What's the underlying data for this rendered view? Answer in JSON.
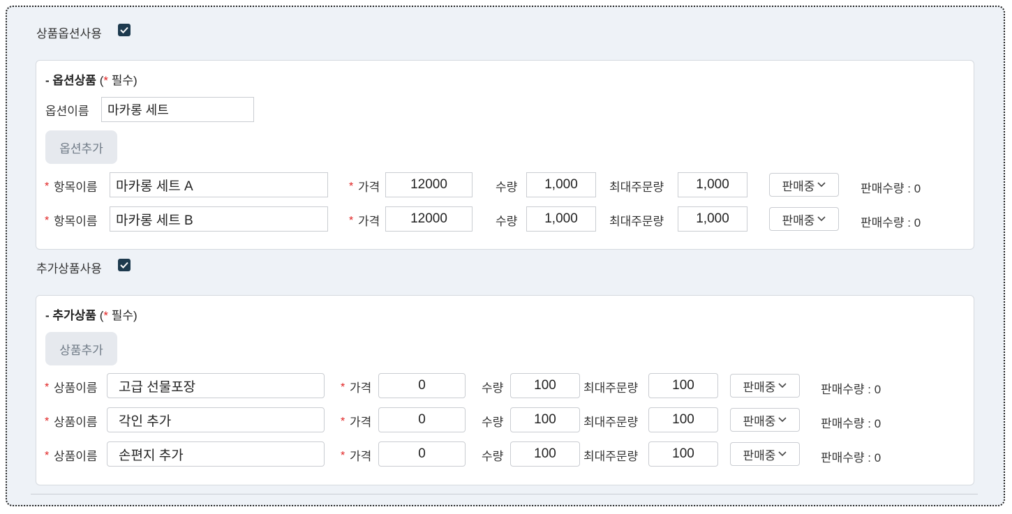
{
  "option_toggle": {
    "label": "상품옵션사용",
    "checked": true
  },
  "option_panel": {
    "title_prefix": "- 옵션상품",
    "title_open": "(",
    "title_star": "*",
    "title_suffix": " 필수)",
    "name_label": "옵션이름",
    "name_value": "마카롱 세트",
    "add_button": "옵션추가",
    "rows": [
      {
        "name_label": "항목이름",
        "name_value": "마카롱 세트 A",
        "price_label": "가격",
        "price_value": "12000",
        "qty_label": "수량",
        "qty_value": "1,000",
        "max_label": "최대주문량",
        "max_value": "1,000",
        "status": "판매중",
        "sold_label": "판매수량 : 0"
      },
      {
        "name_label": "항목이름",
        "name_value": "마카롱 세트 B",
        "price_label": "가격",
        "price_value": "12000",
        "qty_label": "수량",
        "qty_value": "1,000",
        "max_label": "최대주문량",
        "max_value": "1,000",
        "status": "판매중",
        "sold_label": "판매수량 : 0"
      }
    ]
  },
  "addon_toggle": {
    "label": "추가상품사용",
    "checked": true
  },
  "addon_panel": {
    "title_prefix": "- 추가상품",
    "title_open": "(",
    "title_star": "*",
    "title_suffix": " 필수)",
    "add_button": "상품추가",
    "rows": [
      {
        "name_label": "상품이름",
        "name_value": "고급 선물포장",
        "price_label": "가격",
        "price_value": "0",
        "qty_label": "수량",
        "qty_value": "100",
        "max_label": "최대주문량",
        "max_value": "100",
        "status": "판매중",
        "sold_label": "판매수량 : 0"
      },
      {
        "name_label": "상품이름",
        "name_value": "각인 추가",
        "price_label": "가격",
        "price_value": "0",
        "qty_label": "수량",
        "qty_value": "100",
        "max_label": "최대주문량",
        "max_value": "100",
        "status": "판매중",
        "sold_label": "판매수량 : 0"
      },
      {
        "name_label": "상품이름",
        "name_value": "손편지 추가",
        "price_label": "가격",
        "price_value": "0",
        "qty_label": "수량",
        "qty_value": "100",
        "max_label": "최대주문량",
        "max_value": "100",
        "status": "판매중",
        "sold_label": "판매수량 : 0"
      }
    ]
  },
  "colors": {
    "accent": "#1d3a4e",
    "required": "#e02020",
    "background": "#eef2f7"
  }
}
